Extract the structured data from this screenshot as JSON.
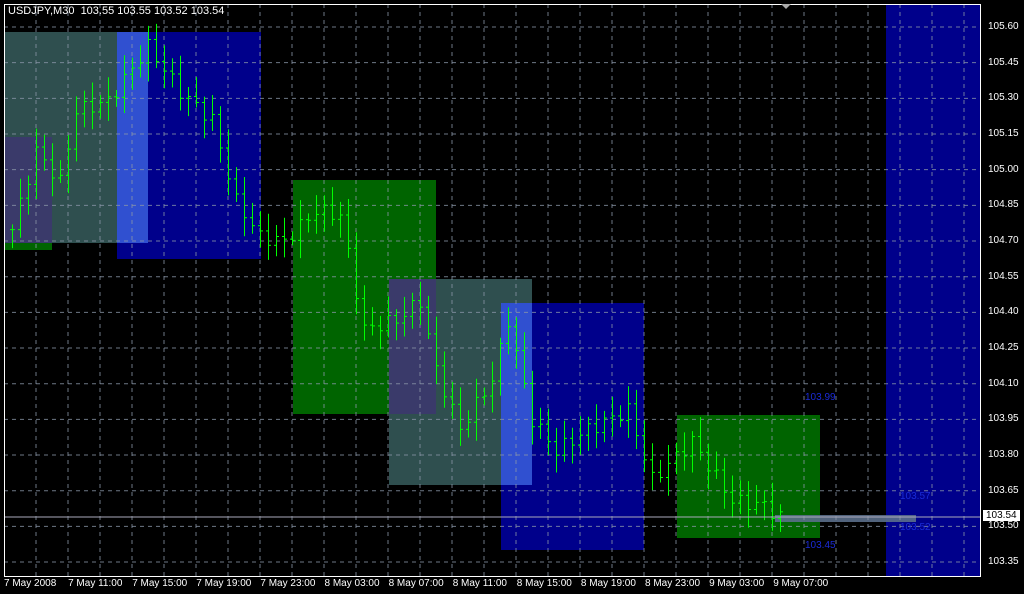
{
  "header": {
    "symbol": "USDJPY,M30",
    "open": "103.55",
    "high": "103.55",
    "low": "103.52",
    "close": "103.54"
  },
  "price_axis": [
    "105.60",
    "105.45",
    "105.30",
    "105.15",
    "105.00",
    "104.85",
    "104.70",
    "104.55",
    "104.40",
    "104.25",
    "104.10",
    "103.95",
    "103.80",
    "103.65",
    "103.50",
    "103.35"
  ],
  "current_price": "103.54",
  "time_axis": [
    "7 May 2008",
    "7 May 11:00",
    "7 May 15:00",
    "7 May 19:00",
    "7 May 23:00",
    "8 May 03:00",
    "8 May 07:00",
    "8 May 11:00",
    "8 May 15:00",
    "8 May 19:00",
    "8 May 23:00",
    "9 May 03:00",
    "9 May 07:00"
  ],
  "object_labels": {
    "high_1": "103.99",
    "low_1": "103.45",
    "high_2": "103.57",
    "low_2": "103.52"
  },
  "colors": {
    "bar": "#00ff00",
    "grid": "#8a96a8",
    "slate": "#2f4f4f",
    "navy": "#00008b",
    "green": "#006400"
  },
  "price_keypoints": [
    [
      0,
      104.75
    ],
    [
      3,
      105.08
    ],
    [
      6,
      104.95
    ],
    [
      8,
      105.25
    ],
    [
      12,
      105.29
    ],
    [
      17,
      105.52
    ],
    [
      21,
      105.33
    ],
    [
      25,
      105.21
    ],
    [
      28,
      104.87
    ],
    [
      31,
      104.72
    ],
    [
      34,
      104.7
    ],
    [
      38,
      104.83
    ],
    [
      41,
      104.81
    ],
    [
      44,
      104.33
    ],
    [
      48,
      104.37
    ],
    [
      51,
      104.45
    ],
    [
      53,
      104.16
    ],
    [
      56,
      103.91
    ],
    [
      60,
      104.12
    ],
    [
      62,
      104.37
    ],
    [
      65,
      103.95
    ],
    [
      68,
      103.82
    ],
    [
      72,
      103.91
    ],
    [
      77,
      103.99
    ],
    [
      80,
      103.7
    ],
    [
      85,
      103.86
    ],
    [
      90,
      103.61
    ],
    [
      94,
      103.59
    ],
    [
      96,
      103.54
    ]
  ]
}
